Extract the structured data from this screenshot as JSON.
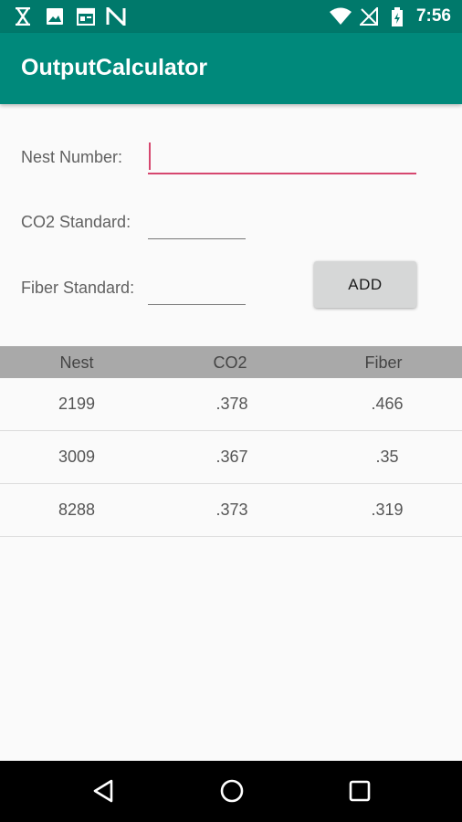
{
  "status_bar": {
    "time": "7:56",
    "left_icons": [
      "hourglass-icon",
      "image-icon",
      "calendar-icon",
      "n-logo-icon"
    ],
    "right_icons": [
      "wifi-icon",
      "no-signal-icon",
      "battery-icon"
    ]
  },
  "app_bar": {
    "title": "OutputCalculator",
    "color": "#00897b"
  },
  "form": {
    "nest_number": {
      "label": "Nest Number:",
      "value": ""
    },
    "co2_standard": {
      "label": "CO2 Standard:",
      "value": ""
    },
    "fiber_standard": {
      "label": "Fiber Standard:",
      "value": ""
    },
    "add_label": "ADD",
    "accent_color": "#d6476f"
  },
  "table": {
    "headers": [
      "Nest",
      "CO2",
      "Fiber"
    ],
    "rows": [
      [
        "2199",
        ".378",
        ".466"
      ],
      [
        "3009",
        ".367",
        ".35"
      ],
      [
        "8288",
        ".373",
        ".319"
      ]
    ]
  },
  "nav_bar": {
    "icons": [
      "back-icon",
      "home-icon",
      "recents-icon"
    ]
  }
}
